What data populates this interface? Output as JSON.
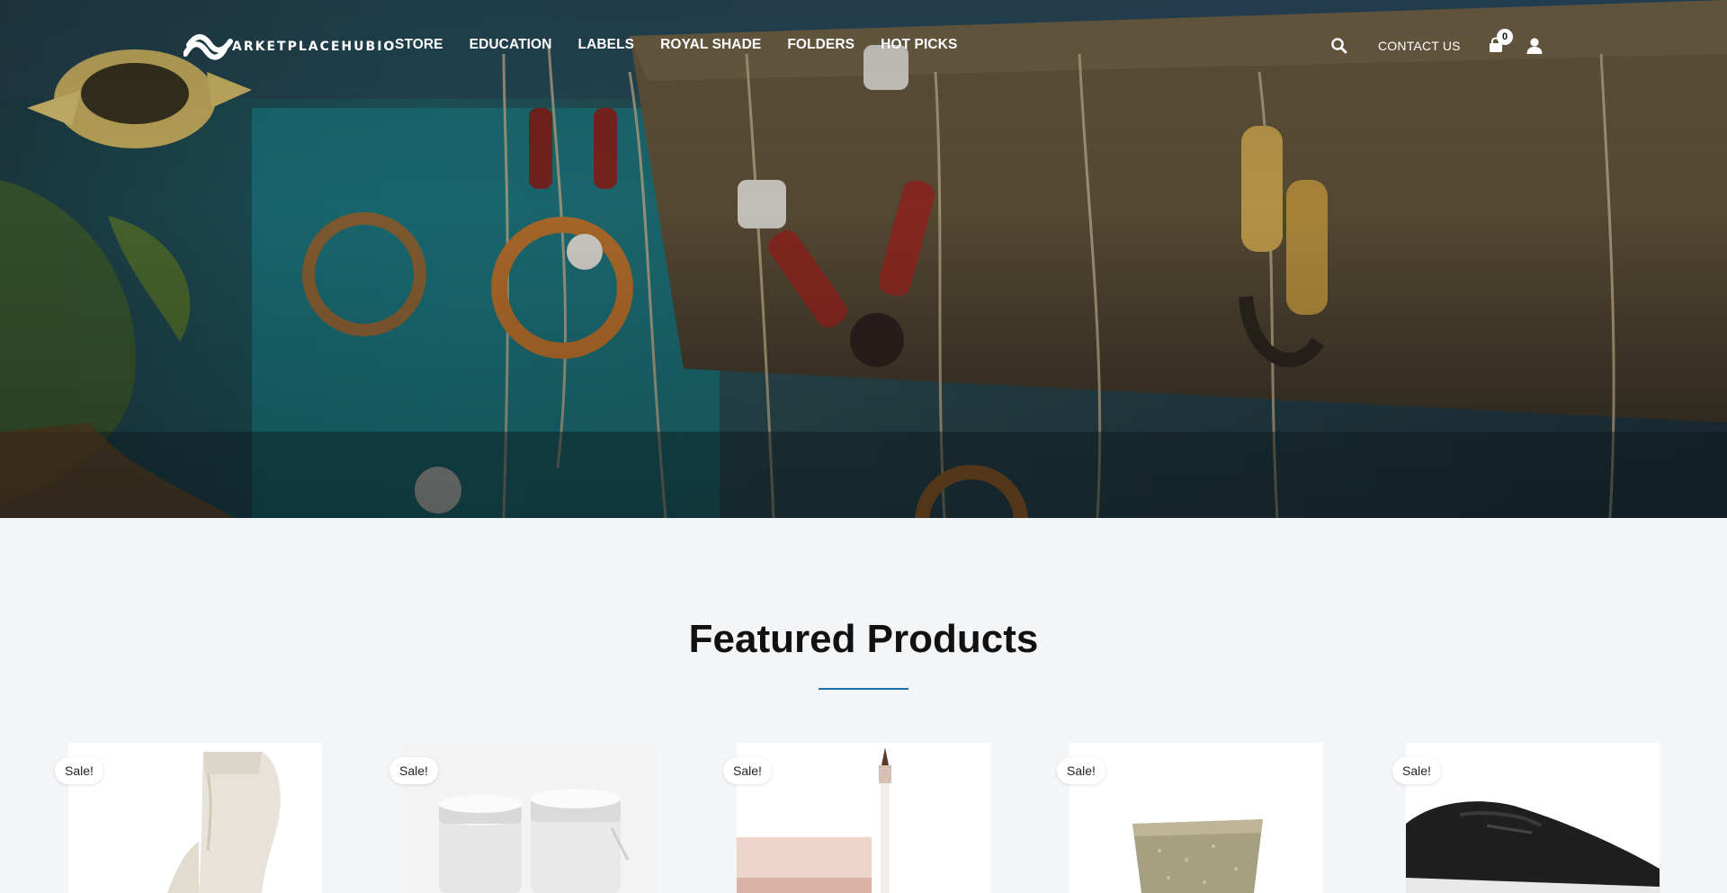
{
  "brand": {
    "logo_text": "ARKETPLACEHUBIO"
  },
  "nav": {
    "items": [
      "STORE",
      "EDUCATION",
      "LABELS",
      "ROYAL SHADE",
      "FOLDERS",
      "HOT PICKS"
    ]
  },
  "header": {
    "contact_label": "CONTACT US",
    "cart_count": "0"
  },
  "icons": {
    "search": "search-icon",
    "cart": "shopping-bag-icon",
    "user": "user-icon"
  },
  "featured": {
    "title": "Featured Products",
    "accent_color": "#1b6fa8",
    "products": [
      {
        "badge": "Sale!",
        "image": "cream-chelsea-boot"
      },
      {
        "badge": "Sale!",
        "image": "silver-cosmetic-jars"
      },
      {
        "badge": "Sale!",
        "image": "pink-palette-with-brush"
      },
      {
        "badge": "Sale!",
        "image": "gold-glitter-heel"
      },
      {
        "badge": "Sale!",
        "image": "black-penny-loafer"
      }
    ]
  }
}
